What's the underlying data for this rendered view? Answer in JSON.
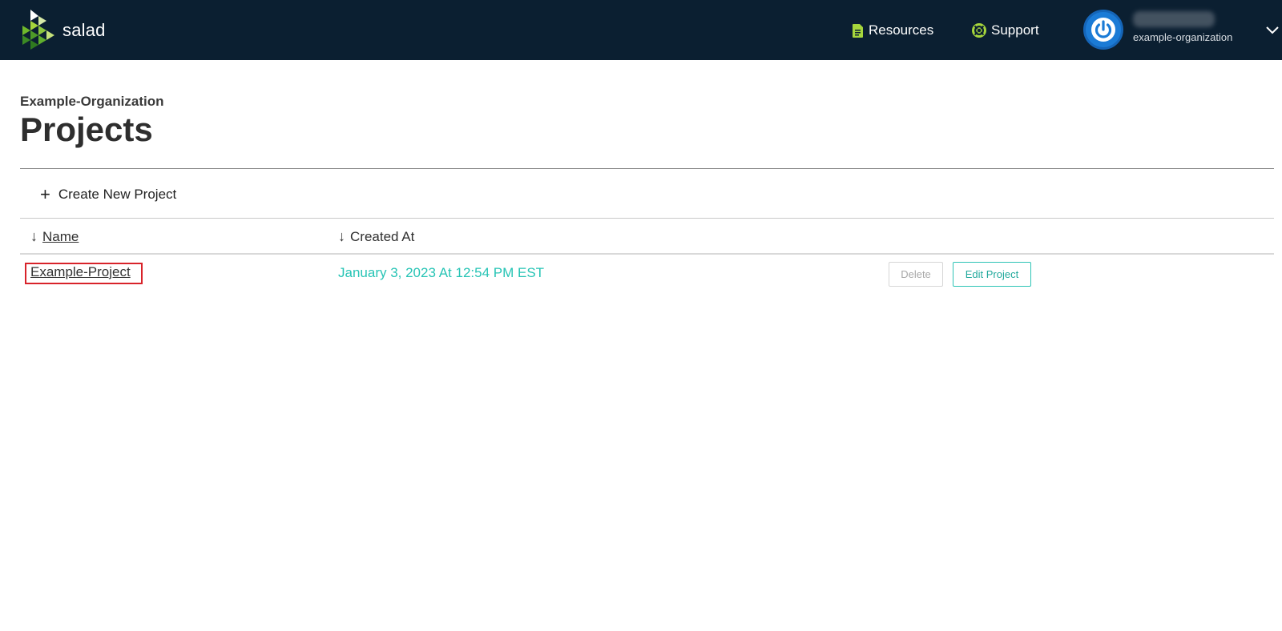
{
  "header": {
    "brand": "salad",
    "nav": {
      "resources_label": "Resources",
      "support_label": "Support"
    },
    "user": {
      "org_name": "example-organization"
    },
    "colors": {
      "bar_bg": "#0b1f31",
      "icon_green": "#a6d63c",
      "avatar_blue": "#1b7bd6"
    }
  },
  "page": {
    "org_title": "Example-Organization",
    "title": "Projects",
    "create_label": "Create New Project"
  },
  "table": {
    "columns": {
      "name": "Name",
      "created_at": "Created At"
    },
    "rows": [
      {
        "name": "Example-Project",
        "created_at": "January 3, 2023 At 12:54 PM EST",
        "delete_label": "Delete",
        "edit_label": "Edit Project"
      }
    ]
  },
  "colors": {
    "accent_teal": "#27c4b5",
    "highlight_red": "#d8232a"
  }
}
